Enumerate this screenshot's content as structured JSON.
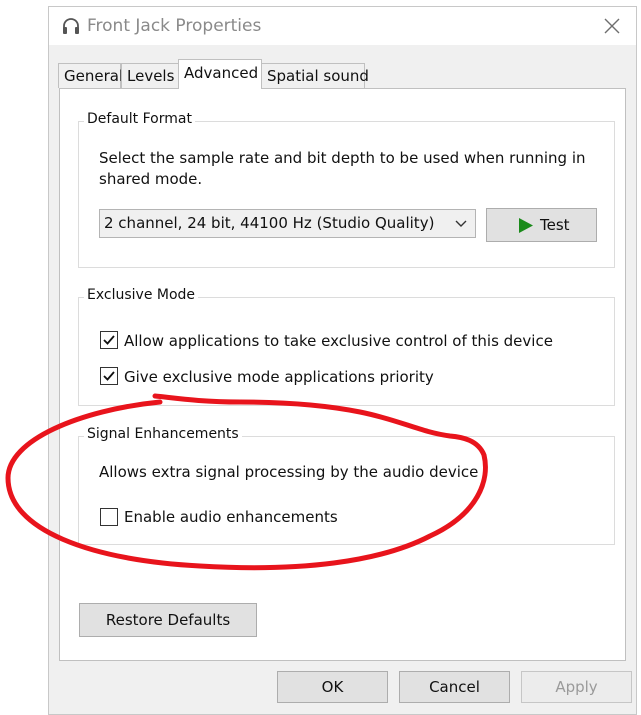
{
  "window": {
    "title": "Front Jack Properties",
    "icon": "headphones-icon",
    "close_icon": "close-icon"
  },
  "tabs": [
    {
      "label": "General",
      "active": false
    },
    {
      "label": "Levels",
      "active": false
    },
    {
      "label": "Advanced",
      "active": true
    },
    {
      "label": "Spatial sound",
      "active": false
    }
  ],
  "default_format": {
    "title": "Default Format",
    "description": "Select the sample rate and bit depth to be used when running in shared mode.",
    "selected_format": "2 channel, 24 bit, 44100 Hz (Studio Quality)",
    "test_label": "Test",
    "test_icon": "play-icon",
    "play_color": "#1a8a1a"
  },
  "exclusive_mode": {
    "title": "Exclusive Mode",
    "options": [
      {
        "label": "Allow applications to take exclusive control of this device",
        "checked": true
      },
      {
        "label": "Give exclusive mode applications priority",
        "checked": true
      }
    ]
  },
  "signal_enhancements": {
    "title": "Signal Enhancements",
    "description": "Allows extra signal processing by the audio device",
    "option": {
      "label": "Enable audio enhancements",
      "checked": false
    }
  },
  "restore_defaults_label": "Restore Defaults",
  "footer": {
    "ok_label": "OK",
    "cancel_label": "Cancel",
    "apply_label": "Apply",
    "apply_enabled": false
  },
  "annotation": {
    "color": "#e8141c",
    "shape": "hand-drawn ellipse around Signal Enhancements"
  }
}
